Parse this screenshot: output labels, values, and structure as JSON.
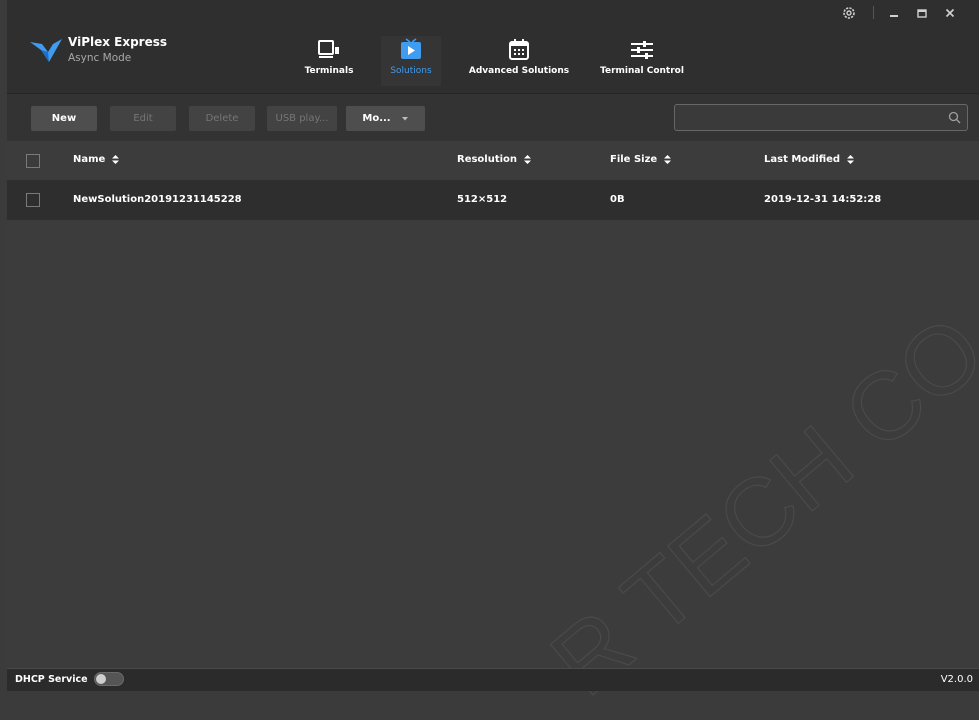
{
  "app": {
    "name": "ViPlex Express",
    "mode": "Async Mode",
    "brand_color": "#3f9cf0"
  },
  "nav": {
    "tabs": [
      {
        "label": "Terminals",
        "icon": "monitor-icon",
        "active": false
      },
      {
        "label": "Solutions",
        "icon": "play-screen-icon",
        "active": true
      },
      {
        "label": "Advanced Solutions",
        "icon": "calendar-icon",
        "active": false
      },
      {
        "label": "Terminal Control",
        "icon": "sliders-icon",
        "active": false
      }
    ]
  },
  "window_controls": [
    "settings-icon",
    "minimize-icon",
    "maximize-icon",
    "close-icon"
  ],
  "toolbar": {
    "new_label": "New",
    "edit_label": "Edit",
    "delete_label": "Delete",
    "usb_label": "USB play...",
    "more_label": "Mo...",
    "search": {
      "value": "",
      "placeholder": ""
    }
  },
  "table": {
    "columns": [
      "Name",
      "Resolution",
      "File Size",
      "Last Modified"
    ],
    "rows": [
      {
        "name": "NewSolution20191231145228",
        "resolution": "512×512",
        "file_size": "0B",
        "last_modified": "2019-12-31 14:52:28",
        "checked": false
      }
    ]
  },
  "status": {
    "dhcp_label": "DHCP Service",
    "dhcp_enabled": false,
    "version": "V2.0.0"
  },
  "watermark": "R TECH CO"
}
